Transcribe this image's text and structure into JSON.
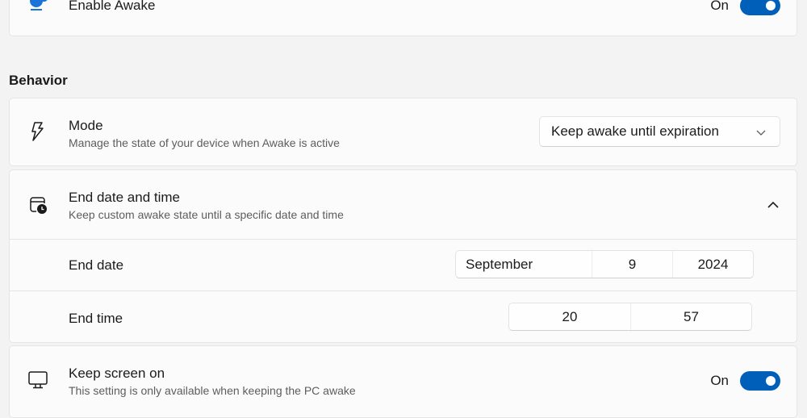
{
  "enable_awake": {
    "title": "Enable Awake",
    "toggle_label": "On",
    "toggle_on": true,
    "icon": "coffee-cup-icon"
  },
  "behavior": {
    "heading": "Behavior",
    "mode": {
      "title": "Mode",
      "description": "Manage the state of your device when Awake is active",
      "selected": "Keep awake until expiration",
      "icon": "lightning-icon"
    },
    "end_date_time": {
      "title": "End date and time",
      "description": "Keep custom awake state until a specific date and time",
      "icon": "calendar-clock-icon",
      "expanded": true,
      "end_date": {
        "label": "End date",
        "month": "September",
        "day": "9",
        "year": "2024"
      },
      "end_time": {
        "label": "End time",
        "hour": "20",
        "minute": "57"
      }
    },
    "keep_screen_on": {
      "title": "Keep screen on",
      "description": "This setting is only available when keeping the PC awake",
      "toggle_label": "On",
      "toggle_on": true,
      "icon": "monitor-icon"
    }
  },
  "colors": {
    "accent": "#005fb8",
    "background": "#f3f3f3",
    "card": "#fbfbfb"
  }
}
